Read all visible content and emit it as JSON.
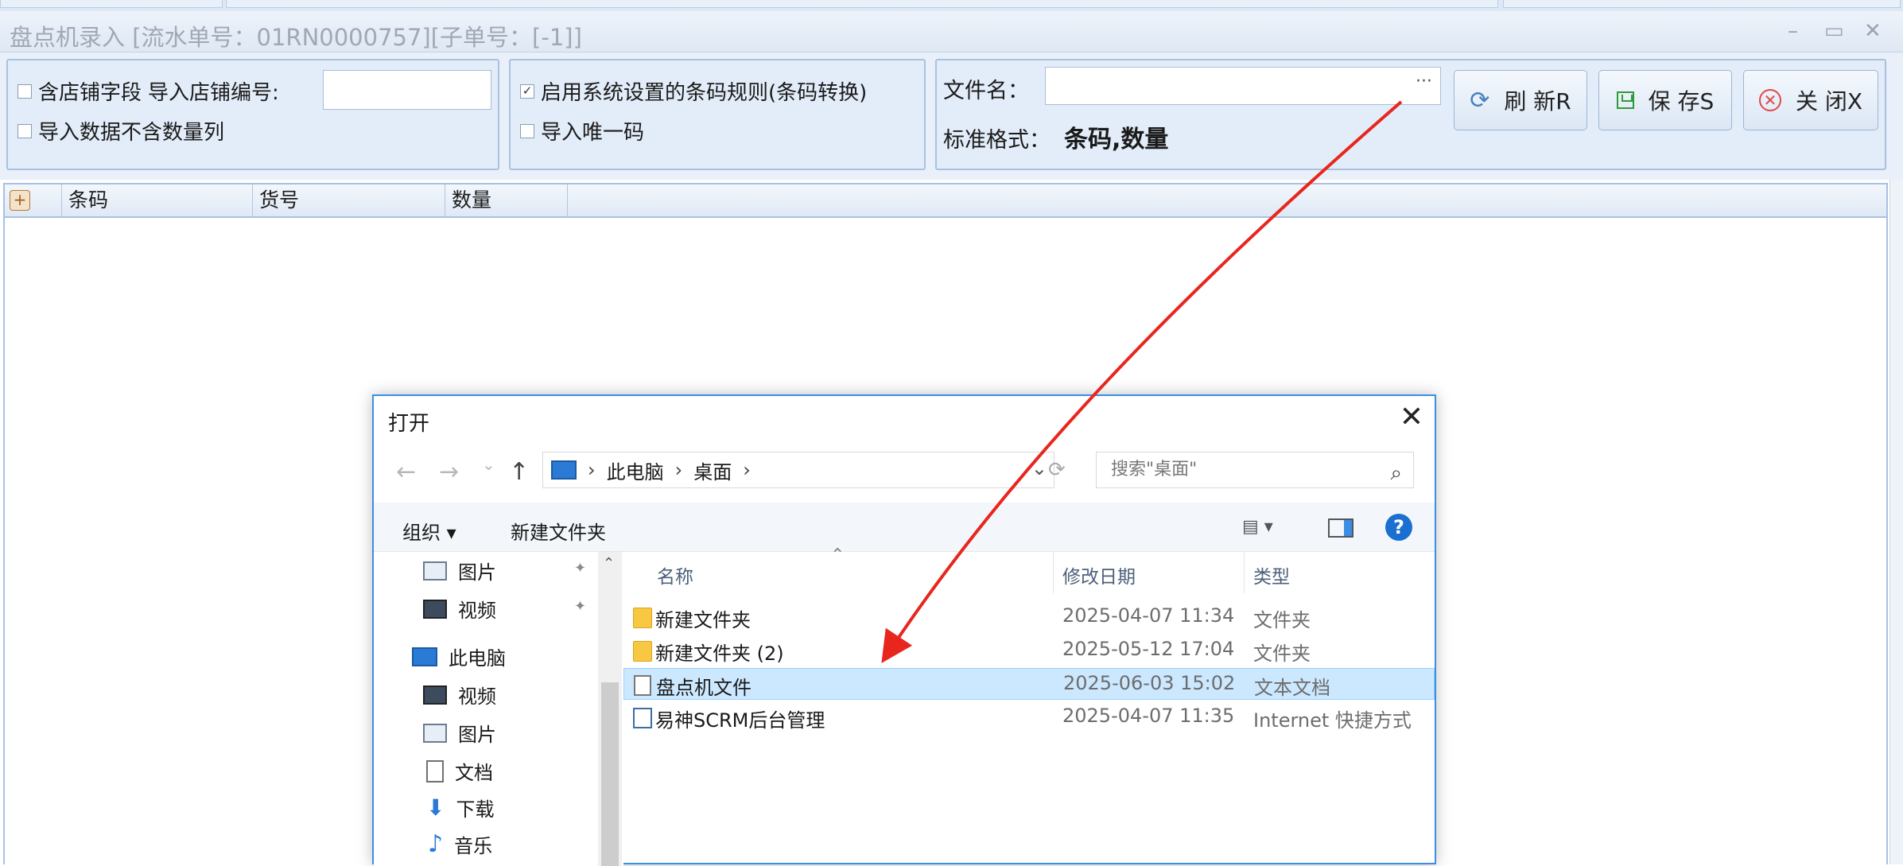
{
  "window": {
    "title": "盘点机录入 [流水单号：01RN0000757][子单号：[-1]]",
    "minimize": "–",
    "maximize": "▭",
    "close": "✕"
  },
  "options": {
    "include_store_field": "含店铺字段",
    "import_store_no_label": "导入店铺编号:",
    "import_store_no_value": "",
    "no_qty_column": "导入数据不含数量列",
    "use_barcode_rule": "启用系统设置的条码规则(条码转换)",
    "import_unique_code": "导入唯一码"
  },
  "file": {
    "filename_label": "文件名：",
    "filename_value": "",
    "browse": "···",
    "format_label": "标准格式：",
    "format_value": "条码,数量"
  },
  "buttons": {
    "refresh": "刷 新R",
    "save": "保 存S",
    "close": "关 闭X"
  },
  "grid": {
    "columns": [
      "条码",
      "货号",
      "数量"
    ],
    "add_icon": "+"
  },
  "dialog": {
    "title": "打开",
    "close": "✕",
    "nav_back": "←",
    "nav_forward": "→",
    "nav_recent": "⌄",
    "nav_up": "↑",
    "breadcrumb": [
      "此电脑",
      "桌面"
    ],
    "breadcrumb_sep": "›",
    "search_placeholder": "搜索\"桌面\"",
    "organize": "组织 ▾",
    "new_folder": "新建文件夹",
    "help": "?",
    "view_glyph": "▤ ▾",
    "nav_items": [
      {
        "label": "图片",
        "icon": "picture-icon",
        "pinned": true
      },
      {
        "label": "视频",
        "icon": "video-icon",
        "pinned": true
      },
      {
        "label": "此电脑",
        "icon": "computer-icon"
      },
      {
        "label": "视频",
        "icon": "video-icon"
      },
      {
        "label": "图片",
        "icon": "picture-icon"
      },
      {
        "label": "文档",
        "icon": "document-icon"
      },
      {
        "label": "下载",
        "icon": "download-icon"
      },
      {
        "label": "音乐",
        "icon": "music-icon"
      }
    ],
    "columns": {
      "name": "名称",
      "modified": "修改日期",
      "type": "类型"
    },
    "files": [
      {
        "name": "新建文件夹",
        "modified": "2025-04-07 11:34",
        "type": "文件夹",
        "icon": "folder-icon",
        "selected": false
      },
      {
        "name": "新建文件夹 (2)",
        "modified": "2025-05-12 17:04",
        "type": "文件夹",
        "icon": "folder-icon",
        "selected": false
      },
      {
        "name": "盘点机文件",
        "modified": "2025-06-03 15:02",
        "type": "文本文档",
        "icon": "text-file-icon",
        "selected": true
      },
      {
        "name": "易神SCRM后台管理",
        "modified": "2025-04-07 11:35",
        "type": "Internet 快捷方式",
        "icon": "shortcut-icon",
        "selected": false
      }
    ]
  },
  "colors": {
    "annotation_arrow": "#e8261e",
    "selection": "#cce8ff",
    "panel": "#e3edf9",
    "accent": "#3a8ee6"
  }
}
